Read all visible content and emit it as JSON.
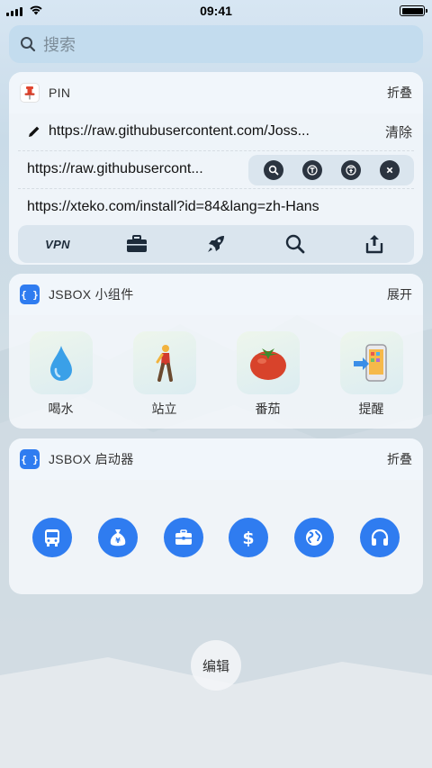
{
  "status": {
    "time": "09:41"
  },
  "search": {
    "placeholder": "搜索",
    "icon": "search-icon"
  },
  "pin_card": {
    "title": "PIN",
    "action": "折叠",
    "clipboard": {
      "text": "https://raw.githubusercontent.com/Joss...",
      "clear_label": "清除"
    },
    "history": [
      "https://raw.githubusercont...",
      "https://xteko.com/install?id=84&lang=zh-Hans"
    ],
    "row_actions": [
      "search-icon",
      "text-icon",
      "pin-top-icon",
      "close-icon"
    ],
    "toolbar": {
      "vpn_label": "VPN",
      "icons": [
        "toolbox-icon",
        "rocket-icon",
        "search-icon",
        "share-icon"
      ]
    }
  },
  "widgets_card": {
    "title": "JSBOX 小组件",
    "action": "展开",
    "items": [
      {
        "label": "喝水",
        "icon": "water-drop-icon"
      },
      {
        "label": "站立",
        "icon": "walking-person-icon"
      },
      {
        "label": "番茄",
        "icon": "tomato-icon"
      },
      {
        "label": "提醒",
        "icon": "phone-reminder-icon"
      }
    ]
  },
  "launcher_card": {
    "title": "JSBOX 启动器",
    "action": "折叠",
    "items": [
      "bus-icon",
      "money-bag-icon",
      "briefcase-icon",
      "dollar-icon",
      "globe-icon",
      "headphones-icon"
    ],
    "accent": "#2f7cf0"
  },
  "edit_label": "编辑"
}
